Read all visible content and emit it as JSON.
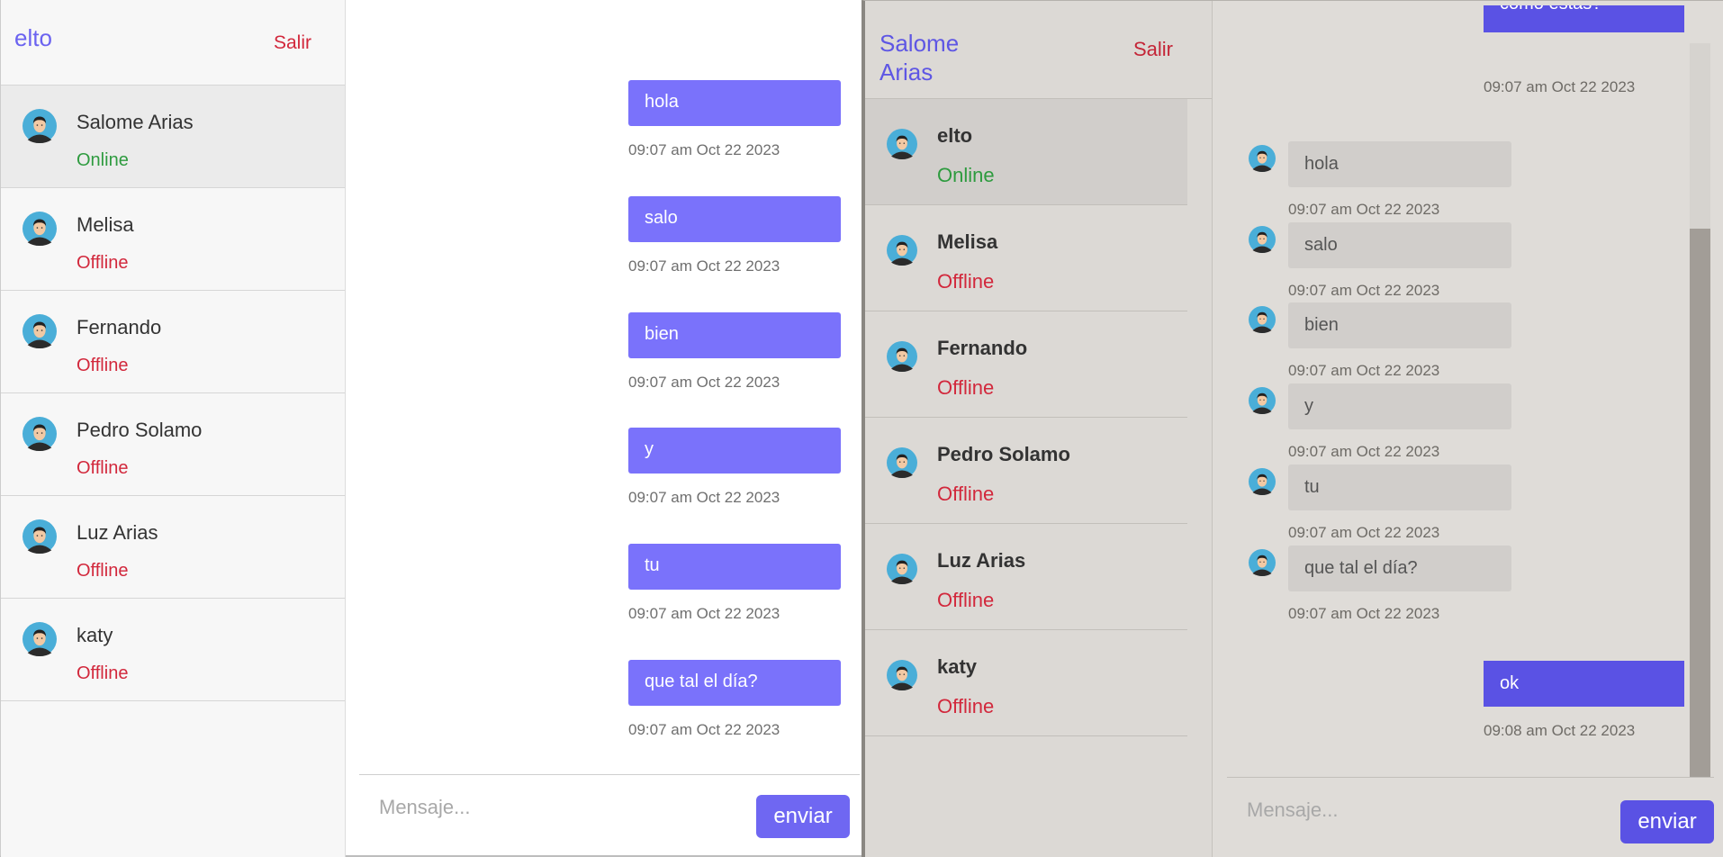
{
  "window1": {
    "sidebar": {
      "title": "elto",
      "logout_label": "Salir",
      "contacts": [
        {
          "name": "Salome Arias",
          "status": "Online"
        },
        {
          "name": "Melisa",
          "status": "Offline"
        },
        {
          "name": "Fernando",
          "status": "Offline"
        },
        {
          "name": "Pedro Solamo",
          "status": "Offline"
        },
        {
          "name": "Luz Arias",
          "status": "Offline"
        },
        {
          "name": "katy",
          "status": "Offline"
        }
      ]
    },
    "chat": {
      "messages": [
        {
          "text": "hola",
          "time": "09:07 am Oct 22 2023"
        },
        {
          "text": "salo",
          "time": "09:07 am Oct 22 2023"
        },
        {
          "text": "bien",
          "time": "09:07 am Oct 22 2023"
        },
        {
          "text": "y",
          "time": "09:07 am Oct 22 2023"
        },
        {
          "text": "tu",
          "time": "09:07 am Oct 22 2023"
        },
        {
          "text": "que tal el día?",
          "time": "09:07 am Oct 22 2023"
        }
      ],
      "input_placeholder": "Mensaje...",
      "send_label": "enviar"
    }
  },
  "window2": {
    "sidebar": {
      "title": "Salome Arias",
      "logout_label": "Salir",
      "contacts": [
        {
          "name": "elto",
          "status": "Online"
        },
        {
          "name": "Melisa",
          "status": "Offline"
        },
        {
          "name": "Fernando",
          "status": "Offline"
        },
        {
          "name": "Pedro Solamo",
          "status": "Offline"
        },
        {
          "name": "Luz Arias",
          "status": "Offline"
        },
        {
          "name": "katy",
          "status": "Offline"
        }
      ]
    },
    "chat": {
      "partial_outgoing": {
        "text": "como estas?",
        "time": "09:07 am Oct 22 2023"
      },
      "incoming": [
        {
          "text": "hola",
          "time": "09:07 am Oct 22 2023"
        },
        {
          "text": "salo",
          "time": "09:07 am Oct 22 2023"
        },
        {
          "text": "bien",
          "time": "09:07 am Oct 22 2023"
        },
        {
          "text": "y",
          "time": "09:07 am Oct 22 2023"
        },
        {
          "text": "tu",
          "time": "09:07 am Oct 22 2023"
        },
        {
          "text": "que tal el día?",
          "time": "09:07 am Oct 22 2023"
        }
      ],
      "last_outgoing": {
        "text": "ok",
        "time": "09:08 am Oct 22 2023"
      },
      "input_placeholder": "Mensaje...",
      "send_label": "enviar"
    }
  },
  "colors": {
    "accent": "#7a72fb",
    "online": "#2e9b3f",
    "offline": "#d2283c"
  }
}
